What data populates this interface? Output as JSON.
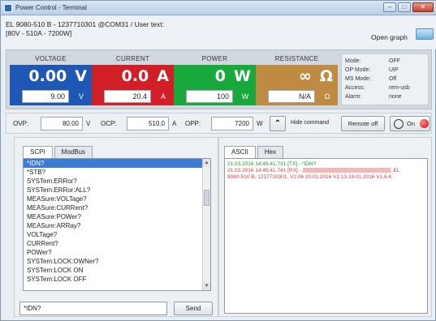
{
  "window": {
    "title": "Power Control - Terminal",
    "min": "–",
    "max": "□",
    "close": "✕"
  },
  "device": {
    "line1": "EL 9080-510 B - 1237710301 @COM31 / User text:",
    "line2": "[80V - 510A - 7200W]",
    "open_graph": "Open graph"
  },
  "gauges": {
    "voltage": {
      "label": "VOLTAGE",
      "value": "0.00",
      "unit": "V",
      "set": "9.00",
      "set_unit": "V"
    },
    "current": {
      "label": "CURRENT",
      "value": "0.0",
      "unit": "A",
      "set": "20.4",
      "set_unit": "A"
    },
    "power": {
      "label": "POWER",
      "value": "0",
      "unit": "W",
      "set": "100",
      "set_unit": "W"
    },
    "resistance": {
      "label": "RESISTANCE",
      "value": "∞",
      "unit": "Ω",
      "set": "N/A",
      "set_unit": "Ω"
    }
  },
  "status": [
    {
      "k": "Mode:",
      "v": "OFF"
    },
    {
      "k": "OP Mode:",
      "v": "UIP"
    },
    {
      "k": "MS Mode:",
      "v": "Off"
    },
    {
      "k": "Access:",
      "v": "rem-usb"
    },
    {
      "k": "Alarm:",
      "v": "none"
    }
  ],
  "protection": {
    "ovp_label": "OVP:",
    "ovp_value": "80.00",
    "ovp_unit": "V",
    "ocp_label": "OCP:",
    "ocp_value": "510.0",
    "ocp_unit": "A",
    "opp_label": "OPP:",
    "opp_value": "7200",
    "opp_unit": "W",
    "hide_icon": "⌃",
    "hide_label": "Hide command",
    "remote_label": "Remote off",
    "on_label": "On"
  },
  "left_tabs": [
    "SCPI",
    "ModBus"
  ],
  "commands": [
    "*IDN?",
    "*STB?",
    "SYSTem:ERRor?",
    "SYSTem:ERRor:ALL?",
    "MEASure:VOLTage?",
    "MEASure:CURRent?",
    "MEASure:POWer?",
    "MEASure:ARRay?",
    "VOLTage?",
    "CURRent?",
    "POWer?",
    "SYSTem:LOCK:OWNer?",
    "SYSTem:LOCK ON",
    "SYSTem:LOCK OFF"
  ],
  "command_input": "*IDN?",
  "send_label": "Send",
  "right_tabs": [
    "ASCII",
    "Hex"
  ],
  "log": {
    "line1": "21.03.2016  14:45:41.731  [TX] - *IDN?",
    "line2": "21.03.2016  14:45:41.741  [RX] -",
    "line2_tail": ", EL",
    "line3": "9080-510 B, 1237710301, V2.06 20.01.2016 V2.13 19.01.2016 V1.6.4."
  },
  "colors": {
    "voltage": "#1f58b4",
    "current": "#d21e26",
    "power": "#17a93c",
    "resistance": "#bf8b43"
  }
}
